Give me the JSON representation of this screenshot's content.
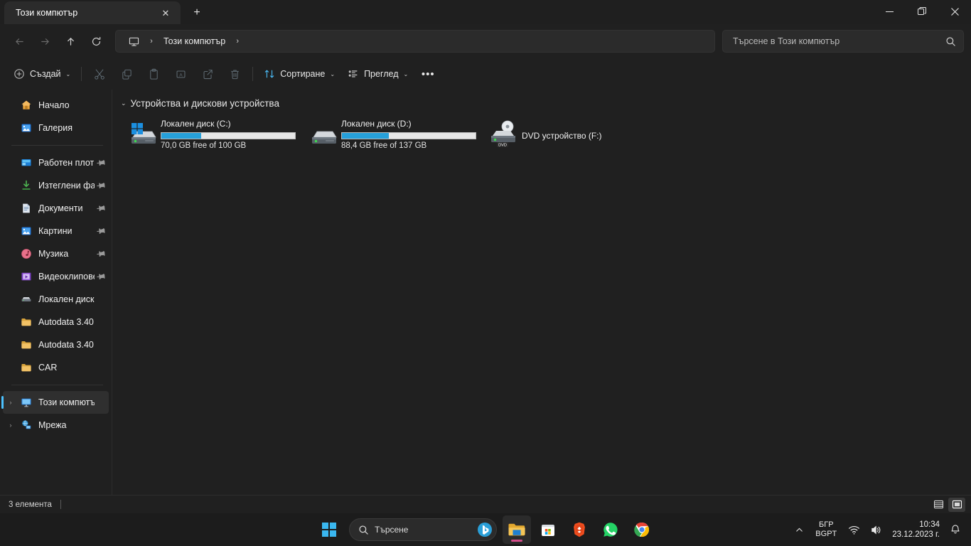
{
  "window": {
    "tab_title": "Този компютър",
    "close_tab_label": "✕",
    "new_tab_label": "+",
    "minimize_label": "—",
    "maximize_label": "❐",
    "close_label": "✕"
  },
  "nav": {
    "back_label": "←",
    "forward_label": "→",
    "up_label": "↑",
    "refresh_label": "⟳",
    "breadcrumb": "Този компютър",
    "breadcrumb_sep": "›",
    "search_placeholder": "Търсене в Този компютър"
  },
  "toolbar": {
    "new_label": "Създай",
    "cut_label": "Изрежи",
    "copy_label": "Копирай",
    "paste_label": "Постави",
    "rename_label": "Преименувай",
    "share_label": "Споделяне",
    "delete_label": "Изтрий",
    "sort_label": "Сортиране",
    "view_label": "Преглед",
    "more_label": "•••",
    "chevron": "⌄"
  },
  "sidebar": {
    "quick": [
      {
        "label": "Начало",
        "icon": "home-icon",
        "pinned": false
      },
      {
        "label": "Галерия",
        "icon": "gallery-icon",
        "pinned": false
      }
    ],
    "pinned": [
      {
        "label": "Работен плот",
        "icon": "desktop-icon",
        "pinned": true
      },
      {
        "label": "Изтеглени файлове",
        "icon": "downloads-icon",
        "pinned": true
      },
      {
        "label": "Документи",
        "icon": "documents-icon",
        "pinned": true
      },
      {
        "label": "Картини",
        "icon": "pictures-icon",
        "pinned": true
      },
      {
        "label": "Музика",
        "icon": "music-icon",
        "pinned": true
      },
      {
        "label": "Видеоклипове",
        "icon": "videos-icon",
        "pinned": true
      },
      {
        "label": "Локален диск (D:)",
        "icon": "drive-icon",
        "pinned": false
      },
      {
        "label": "Autodata 3.40",
        "icon": "folder-icon",
        "pinned": false
      },
      {
        "label": "Autodata 3.40",
        "icon": "folder-icon",
        "pinned": false
      },
      {
        "label": "CAR",
        "icon": "folder-icon",
        "pinned": false
      }
    ],
    "roots": [
      {
        "label": "Този компютър",
        "icon": "this-pc-icon",
        "selected": true
      },
      {
        "label": "Мрежа",
        "icon": "network-icon",
        "selected": false
      }
    ],
    "expander": "›"
  },
  "main": {
    "group_title": "Устройства и дискови устройства",
    "group_chevron": "⌄",
    "drives": [
      {
        "name": "Локален диск (C:)",
        "sub": "70,0 GB free of 100 GB",
        "fill_percent": 30,
        "icon": "hdd-windows-icon",
        "has_bar": true
      },
      {
        "name": "Локален диск (D:)",
        "sub": "88,4 GB free of 137 GB",
        "fill_percent": 35,
        "icon": "hdd-icon",
        "has_bar": true
      },
      {
        "name": "DVD устройство (F:)",
        "sub": "",
        "fill_percent": 0,
        "icon": "dvd-icon",
        "has_bar": false
      }
    ]
  },
  "status": {
    "item_count": "3 елемента",
    "view_details_label": "Подробни данни",
    "view_icons_label": "Големи икони"
  },
  "taskbar": {
    "start_label": "Старт",
    "search_text": "Търсене",
    "apps": [
      {
        "name": "file-explorer",
        "active": true
      },
      {
        "name": "microsoft-store",
        "active": false
      },
      {
        "name": "brave",
        "active": false
      },
      {
        "name": "whatsapp",
        "active": false
      },
      {
        "name": "chrome",
        "active": false
      }
    ],
    "tray": {
      "overflow": "⌃",
      "lang_top": "БГР",
      "lang_bottom": "BGPT",
      "time": "10:34",
      "date": "23.12.2023 г."
    }
  },
  "colors": {
    "accent": "#4cc2ff",
    "bar_fill": "#26a0da",
    "window_bg": "#202020",
    "taskbar_bg": "#1c1c1c"
  }
}
